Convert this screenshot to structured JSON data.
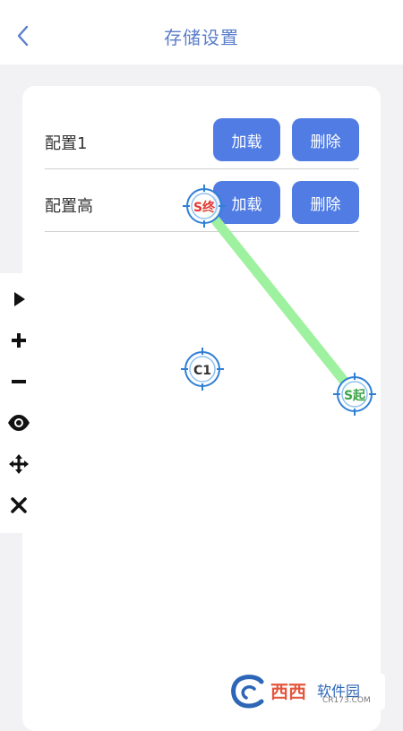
{
  "header": {
    "title": "存储设置",
    "back_icon": "chevron-left-icon"
  },
  "configs": [
    {
      "name": "配置1",
      "load_label": "加载",
      "delete_label": "删除"
    },
    {
      "name": "配置高",
      "load_label": "加载",
      "delete_label": "删除"
    }
  ],
  "markers": {
    "start": "S起",
    "end": "S终",
    "center": "C1"
  },
  "toolbar": {
    "items": [
      "play-icon",
      "plus-icon",
      "minus-icon",
      "eye-icon",
      "move-icon",
      "close-icon"
    ]
  },
  "watermark": {
    "brand": "西西",
    "suffix": "软件园",
    "url": "CR173.COM"
  },
  "colors": {
    "accent": "#507ce4",
    "title": "#5b7ecb",
    "path": "#9ef19e",
    "marker_start_text": "#3ea54a",
    "marker_end_text": "#e53935"
  }
}
